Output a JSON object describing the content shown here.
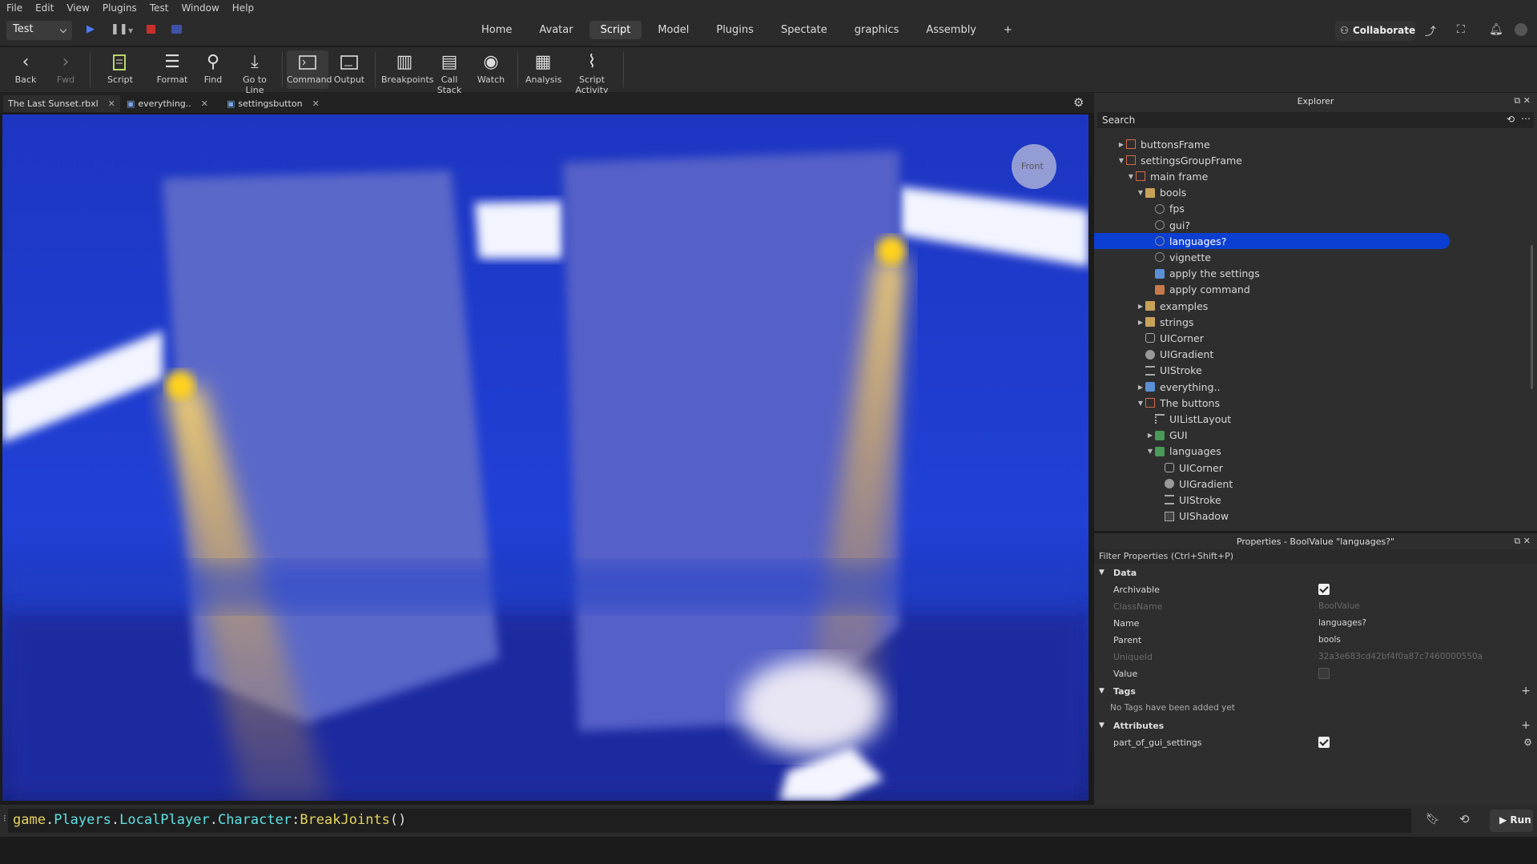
{
  "menu": [
    "File",
    "Edit",
    "View",
    "Plugins",
    "Test",
    "Window",
    "Help"
  ],
  "mode": {
    "selected": "Test"
  },
  "nav_tabs": [
    "Home",
    "Avatar",
    "Script",
    "Model",
    "Plugins",
    "Spectate",
    "graphics",
    "Assembly",
    "+"
  ],
  "active_tab": "Script",
  "collaborate_label": "Collaborate",
  "toolbar": {
    "back": "Back",
    "fwd": "Fwd",
    "script": "Script",
    "format": "Format",
    "find": "Find",
    "goto": "Go to Line",
    "command": "Command",
    "output": "Output",
    "breakpoints": "Breakpoints",
    "callstack": "Call Stack",
    "watch": "Watch",
    "analysis": "Analysis",
    "activity": "Script Activity"
  },
  "doc_tabs": [
    "The Last Sunset.rbxl",
    "everything..",
    "settingsbutton"
  ],
  "viewcube_label": "Front",
  "explorer": {
    "title": "Explorer",
    "search_placeholder": "Search",
    "items": [
      {
        "label": "buttonsFrame"
      },
      {
        "label": "settingsGroupFrame"
      },
      {
        "label": "main frame"
      },
      {
        "label": "bools"
      },
      {
        "label": "fps"
      },
      {
        "label": "gui?"
      },
      {
        "label": "languages?"
      },
      {
        "label": "vignette"
      },
      {
        "label": "apply the settings"
      },
      {
        "label": "apply command"
      },
      {
        "label": "examples"
      },
      {
        "label": "strings"
      },
      {
        "label": "UICorner"
      },
      {
        "label": "UIGradient"
      },
      {
        "label": "UIStroke"
      },
      {
        "label": "everything.."
      },
      {
        "label": "The buttons"
      },
      {
        "label": "UIListLayout"
      },
      {
        "label": "GUI"
      },
      {
        "label": "languages"
      },
      {
        "label": "UICorner"
      },
      {
        "label": "UIGradient"
      },
      {
        "label": "UIStroke"
      },
      {
        "label": "UIShadow"
      }
    ]
  },
  "properties": {
    "title": "Properties - BoolValue \"languages?\"",
    "filter_placeholder": "Filter Properties (Ctrl+Shift+P)",
    "sections": {
      "data": "Data",
      "tags": "Tags",
      "attributes": "Attributes"
    },
    "rows": {
      "archivable": {
        "key": "Archivable",
        "value": true
      },
      "classname": {
        "key": "ClassName",
        "value": "BoolValue"
      },
      "name": {
        "key": "Name",
        "value": "languages?"
      },
      "parent": {
        "key": "Parent",
        "value": "bools"
      },
      "uniqueid": {
        "key": "UniqueId",
        "value": "32a3e683cd42bf4f0a87c7460000550a"
      },
      "value": {
        "key": "Value",
        "value": false
      }
    },
    "no_tags": "No Tags have been added yet",
    "attr": {
      "key": "part_of_gui_settings",
      "value": true
    }
  },
  "command_bar": {
    "code": [
      "game",
      ".",
      "Players",
      ".",
      "LocalPlayer",
      ".",
      "Character",
      ":",
      "BreakJoints",
      "()"
    ]
  },
  "run_label": "Run"
}
